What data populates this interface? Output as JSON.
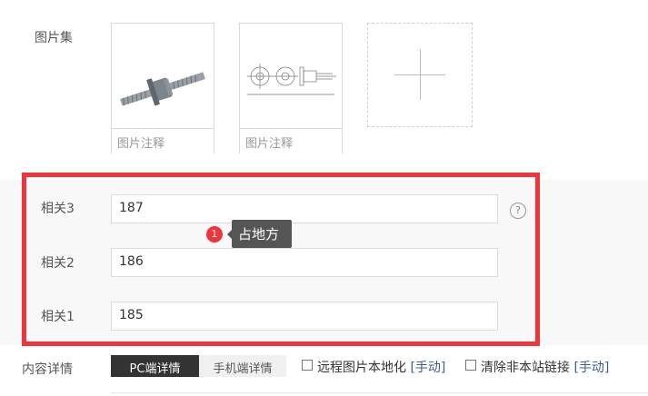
{
  "gallery": {
    "label": "图片集",
    "items": [
      {
        "caption_placeholder": "图片注释",
        "image": "ball-screw-photo"
      },
      {
        "caption_placeholder": "图片注释",
        "image": "technical-drawing"
      }
    ],
    "add_icon": "plus-icon"
  },
  "related": {
    "fields": [
      {
        "label": "相关3",
        "value": "187"
      },
      {
        "label": "相关2",
        "value": "186"
      },
      {
        "label": "相关1",
        "value": "185"
      }
    ],
    "help_icon": "?",
    "badge_count": "1",
    "tooltip": "占地方",
    "highlight_color": "#f0343b"
  },
  "detail": {
    "label": "内容详情",
    "tabs": [
      {
        "label": "PC端详情",
        "active": true
      },
      {
        "label": "手机端详情",
        "active": false
      }
    ],
    "options": [
      {
        "label": "远程图片本地化",
        "link": "[手动]"
      },
      {
        "label": "清除非本站链接",
        "link": "[手动]"
      }
    ]
  }
}
